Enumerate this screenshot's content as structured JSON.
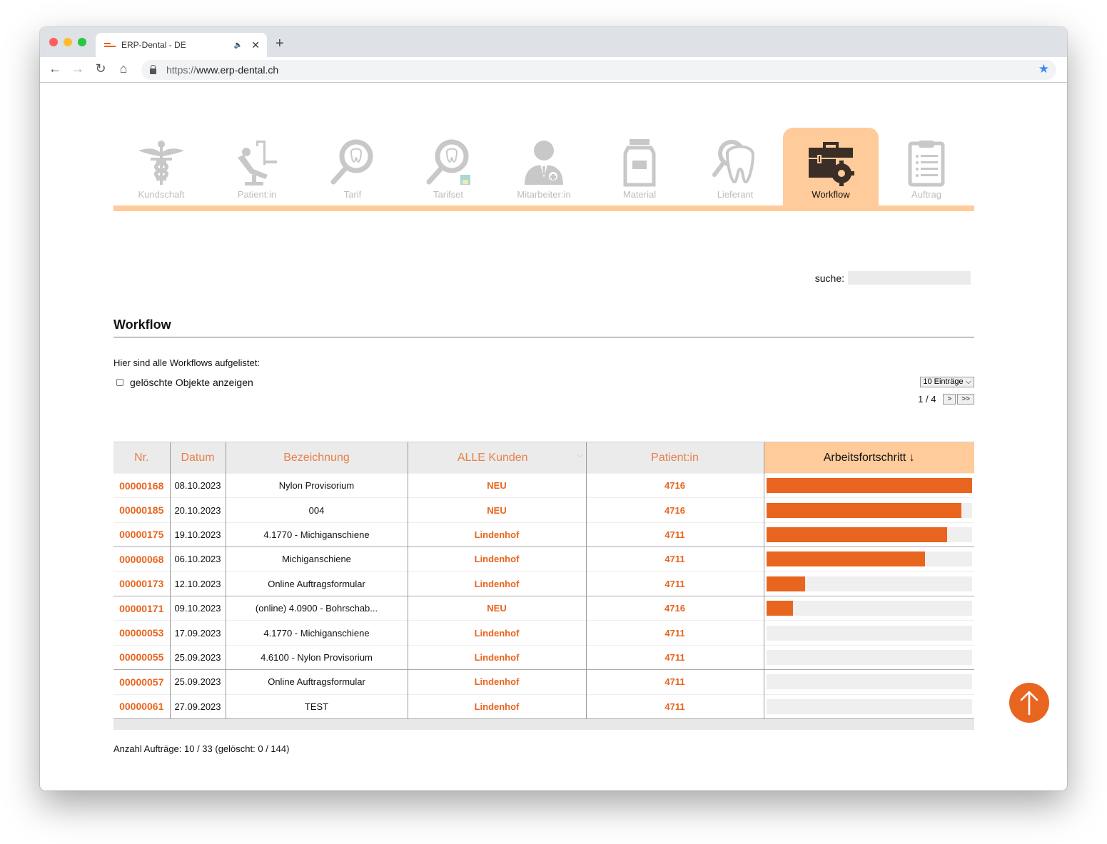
{
  "browser": {
    "tab_title": "ERP-Dental - DE",
    "url_scheme": "https://",
    "url_host": "www.erp-dental.ch"
  },
  "nav": {
    "items": [
      {
        "label": "Kundschaft",
        "icon": "caduceus-icon"
      },
      {
        "label": "Patient:in",
        "icon": "dental-chair-icon"
      },
      {
        "label": "Tarif",
        "icon": "tooth-magnifier-icon"
      },
      {
        "label": "Tarifset",
        "icon": "tooth-magnifier-save-icon"
      },
      {
        "label": "Mitarbeiter:in",
        "icon": "doctor-icon"
      },
      {
        "label": "Material",
        "icon": "jar-icon"
      },
      {
        "label": "Lieferant",
        "icon": "tooth-search-icon"
      },
      {
        "label": "Workflow",
        "icon": "briefcase-gear-icon",
        "active": true
      },
      {
        "label": "Auftrag",
        "icon": "clipboard-icon"
      }
    ]
  },
  "search": {
    "label": "suche:",
    "value": "",
    "placeholder": ""
  },
  "section": {
    "title": "Workflow",
    "intro": "Hier sind alle Workflows aufgelistet:",
    "show_deleted_label": "gelöschte Objekte anzeigen",
    "show_deleted_checked": false,
    "entries_select": "10 Einträge",
    "page_indicator": "1 / 4",
    "next_label": ">",
    "last_label": ">>"
  },
  "table": {
    "headers": {
      "nr": "Nr.",
      "datum": "Datum",
      "bezeichnung": "Bezeichnung",
      "kunden": "ALLE Kunden",
      "patient": "Patient:in",
      "fortschritt": "Arbeitsfortschritt ↓"
    },
    "rows": [
      {
        "nr": "00000168",
        "datum": "08.10.2023",
        "bezeichnung": "Nylon Provisorium",
        "kunde": "NEU",
        "patient": "4716",
        "progress_pct": 100
      },
      {
        "nr": "00000185",
        "datum": "20.10.2023",
        "bezeichnung": "004",
        "kunde": "NEU",
        "patient": "4716",
        "progress_pct": 95
      },
      {
        "nr": "00000175",
        "datum": "19.10.2023",
        "bezeichnung": "4.1770 - Michiganschiene",
        "kunde": "Lindenhof",
        "patient": "4711",
        "progress_pct": 88
      },
      {
        "nr": "00000068",
        "datum": "06.10.2023",
        "bezeichnung": "Michiganschiene",
        "kunde": "Lindenhof",
        "patient": "4711",
        "progress_pct": 77
      },
      {
        "nr": "00000173",
        "datum": "12.10.2023",
        "bezeichnung": "Online Auftragsformular",
        "kunde": "Lindenhof",
        "patient": "4711",
        "progress_pct": 19
      },
      {
        "nr": "00000171",
        "datum": "09.10.2023",
        "bezeichnung": "(online) 4.0900 - Bohrschab...",
        "kunde": "NEU",
        "patient": "4716",
        "progress_pct": 13
      },
      {
        "nr": "00000053",
        "datum": "17.09.2023",
        "bezeichnung": "4.1770 - Michiganschiene",
        "kunde": "Lindenhof",
        "patient": "4711",
        "progress_pct": 0
      },
      {
        "nr": "00000055",
        "datum": "25.09.2023",
        "bezeichnung": "4.6100 - Nylon Provisorium",
        "kunde": "Lindenhof",
        "patient": "4711",
        "progress_pct": 0
      },
      {
        "nr": "00000057",
        "datum": "25.09.2023",
        "bezeichnung": "Online Auftragsformular",
        "kunde": "Lindenhof",
        "patient": "4711",
        "progress_pct": 0
      },
      {
        "nr": "00000061",
        "datum": "27.09.2023",
        "bezeichnung": "TEST",
        "kunde": "Lindenhof",
        "patient": "4711",
        "progress_pct": 0
      }
    ]
  },
  "footer": {
    "count_text": "Anzahl Aufträge: 10 / 33 (gelöscht: 0 / 144)"
  },
  "colors": {
    "accent": "#e8651f",
    "active_tab": "#ffcb9a",
    "icon_inactive": "#c8c8c8",
    "icon_active": "#3a2e26"
  }
}
